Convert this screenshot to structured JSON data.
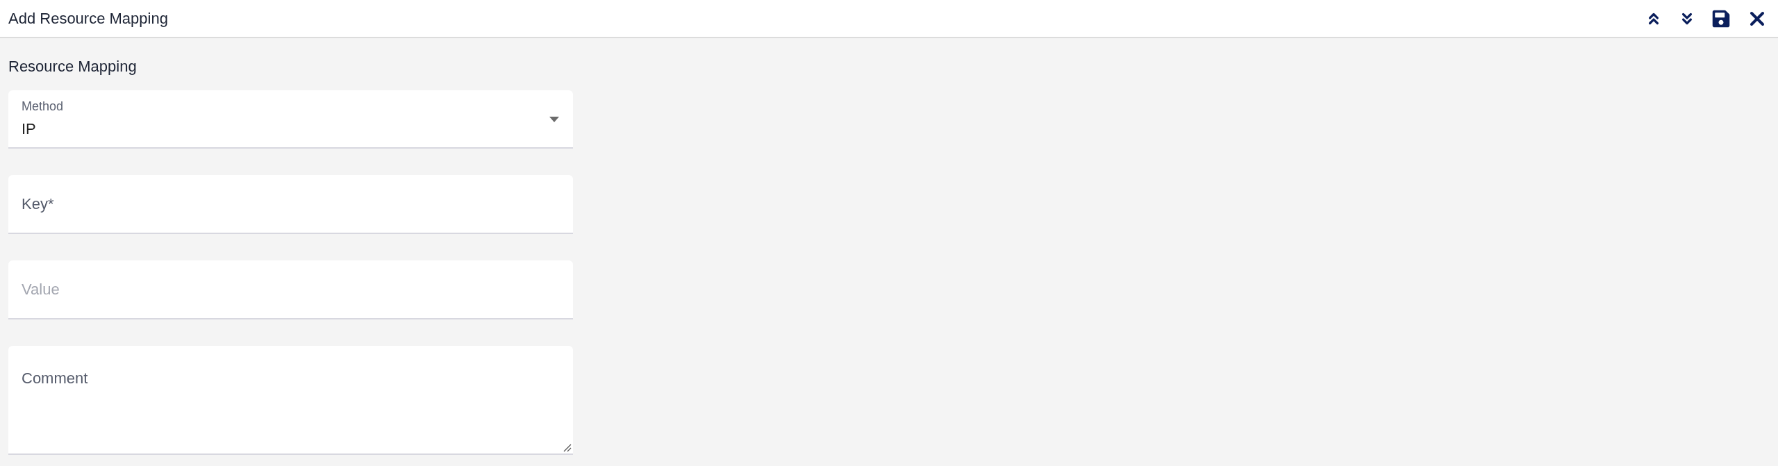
{
  "window": {
    "title": "Add Resource Mapping"
  },
  "toolbar": [
    {
      "kind": "collapse"
    },
    {
      "kind": "expand"
    },
    {
      "kind": "save"
    },
    {
      "kind": "close"
    }
  ],
  "section": {
    "title": "Resource Mapping"
  },
  "fields": [
    {
      "kind": "select",
      "label": "Method",
      "value": "IP"
    },
    {
      "kind": "text",
      "label": "Key*"
    },
    {
      "kind": "text",
      "placeholder": "Value"
    },
    {
      "kind": "textarea",
      "label": "Comment"
    }
  ]
}
